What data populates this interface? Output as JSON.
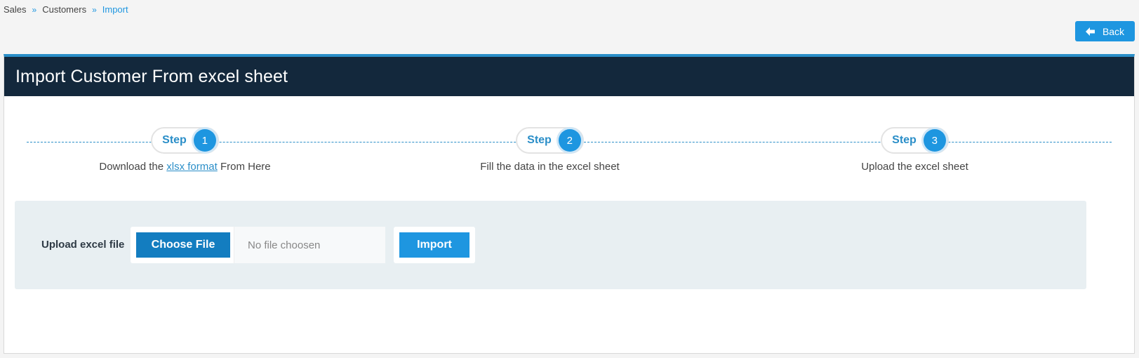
{
  "breadcrumb": {
    "items": [
      "Sales",
      "Customers"
    ],
    "current": "Import",
    "separator": "»"
  },
  "back_button": {
    "label": "Back",
    "icon": "arrow-left-icon"
  },
  "panel": {
    "title": "Import Customer From excel sheet"
  },
  "steps": [
    {
      "word": "Step",
      "number": "1",
      "desc_before": "Download the ",
      "link": "xlsx format",
      "desc_after": " From Here"
    },
    {
      "word": "Step",
      "number": "2",
      "desc": "Fill the data in the excel sheet"
    },
    {
      "word": "Step",
      "number": "3",
      "desc": "Upload the excel sheet"
    }
  ],
  "upload": {
    "label": "Upload excel file",
    "choose_label": "Choose File",
    "file_placeholder": "No file choosen",
    "import_label": "Import"
  },
  "colors": {
    "accent": "#1e96e0",
    "header_bg": "#13283c",
    "upload_bg": "#e8eff2"
  }
}
